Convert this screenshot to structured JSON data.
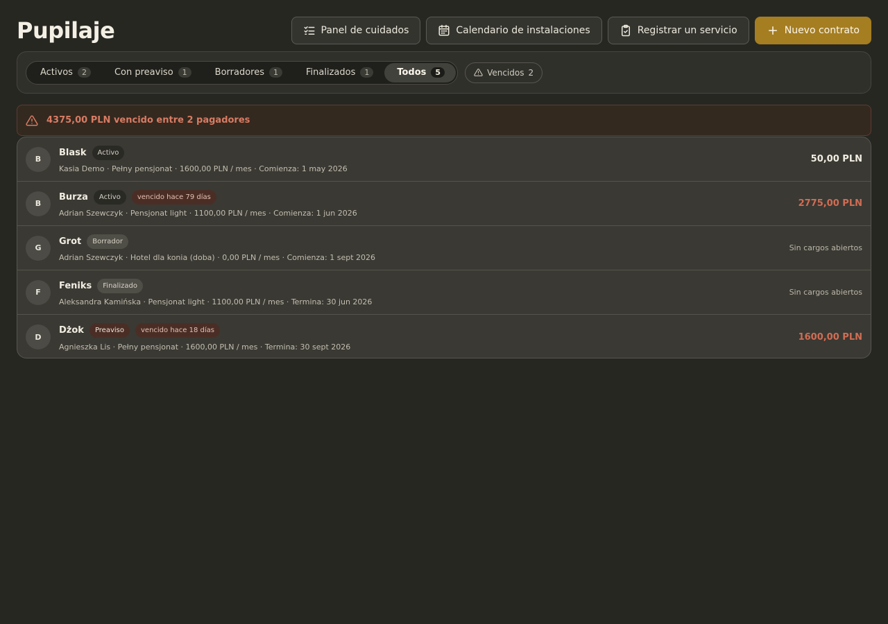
{
  "page": {
    "title": "Pupilaje"
  },
  "actions": {
    "care_panel": "Panel de cuidados",
    "facility_calendar": "Calendario de instalaciones",
    "register_service": "Registrar un servicio",
    "new_contract": "Nuevo contrato"
  },
  "filters": {
    "tabs": [
      {
        "label": "Activos",
        "count": "2"
      },
      {
        "label": "Con preaviso",
        "count": "1"
      },
      {
        "label": "Borradores",
        "count": "1"
      },
      {
        "label": "Finalizados",
        "count": "1"
      },
      {
        "label": "Todos",
        "count": "5"
      }
    ],
    "selected": "Todos",
    "overdue_chip": {
      "label": "Vencidos",
      "count": "2"
    }
  },
  "alert": {
    "text": "4375,00 PLN vencido entre 2 pagadores"
  },
  "contracts": [
    {
      "initial": "B",
      "name": "Blask",
      "status": "Activo",
      "overdue": "",
      "meta": "Kasia Demo · Pełny pensjonat · 1600,00 PLN / mes · Comienza: 1 may 2026",
      "amount": "50,00 PLN"
    },
    {
      "initial": "B",
      "name": "Burza",
      "status": "Activo",
      "overdue": "vencido hace 79 días",
      "meta": "Adrian Szewczyk · Pensjonat light · 1100,00 PLN / mes · Comienza: 1 jun 2026",
      "amount": "2775,00 PLN"
    },
    {
      "initial": "G",
      "name": "Grot",
      "status": "Borrador",
      "overdue": "",
      "meta": "Adrian Szewczyk · Hotel dla konia (doba) · 0,00 PLN / mes · Comienza: 1 sept 2026",
      "amount": "Sin cargos abiertos"
    },
    {
      "initial": "F",
      "name": "Feniks",
      "status": "Finalizado",
      "overdue": "",
      "meta": "Aleksandra Kamińska · Pensjonat light · 1100,00 PLN / mes · Termina: 30 jun 2026",
      "amount": "Sin cargos abiertos"
    },
    {
      "initial": "D",
      "name": "Dżok",
      "status": "Preaviso",
      "overdue": "vencido hace 18 días",
      "meta": "Agnieszka Lis · Pełny pensjonat · 1600,00 PLN / mes · Termina: 30 sept 2026",
      "amount": "1600,00 PLN"
    }
  ],
  "colors": {
    "background": "#272722",
    "accent": "#a57e22",
    "danger": "#d16d55"
  }
}
